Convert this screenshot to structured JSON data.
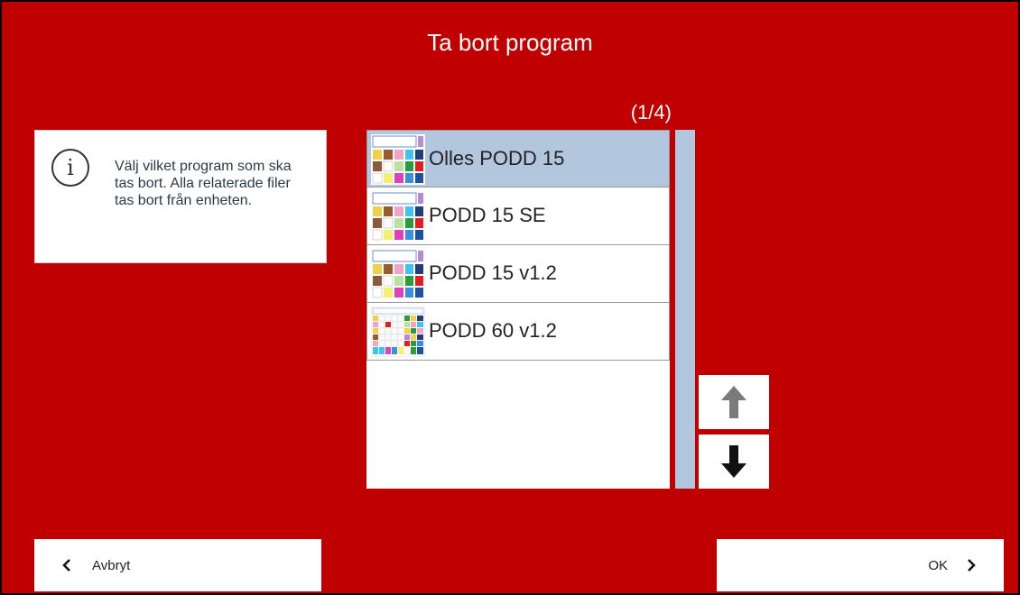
{
  "header": {
    "title": "Ta bort program"
  },
  "info": {
    "icon": "info-icon",
    "text": "Välj vilket program som ska tas bort. Alla relaterade filer tas bort från enheten."
  },
  "list": {
    "counter": "(1/4)",
    "items": [
      {
        "label": "Olles PODD 15",
        "selected": true,
        "thumb": "podd15"
      },
      {
        "label": "PODD 15 SE",
        "selected": false,
        "thumb": "podd15"
      },
      {
        "label": "PODD 15 v1.2",
        "selected": false,
        "thumb": "podd15"
      },
      {
        "label": "PODD 60 v1.2",
        "selected": false,
        "thumb": "podd60"
      }
    ]
  },
  "scroll": {
    "up_icon": "arrow-up-icon",
    "down_icon": "arrow-down-icon"
  },
  "footer": {
    "cancel_label": "Avbryt",
    "cancel_icon": "chevron-left-icon",
    "ok_label": "OK",
    "ok_icon": "chevron-right-icon"
  },
  "colors": {
    "background": "#c00000",
    "selected_row": "#b2c6dd",
    "scrollbar": "#b2c6dd",
    "text_dark": "#2a3b48"
  }
}
